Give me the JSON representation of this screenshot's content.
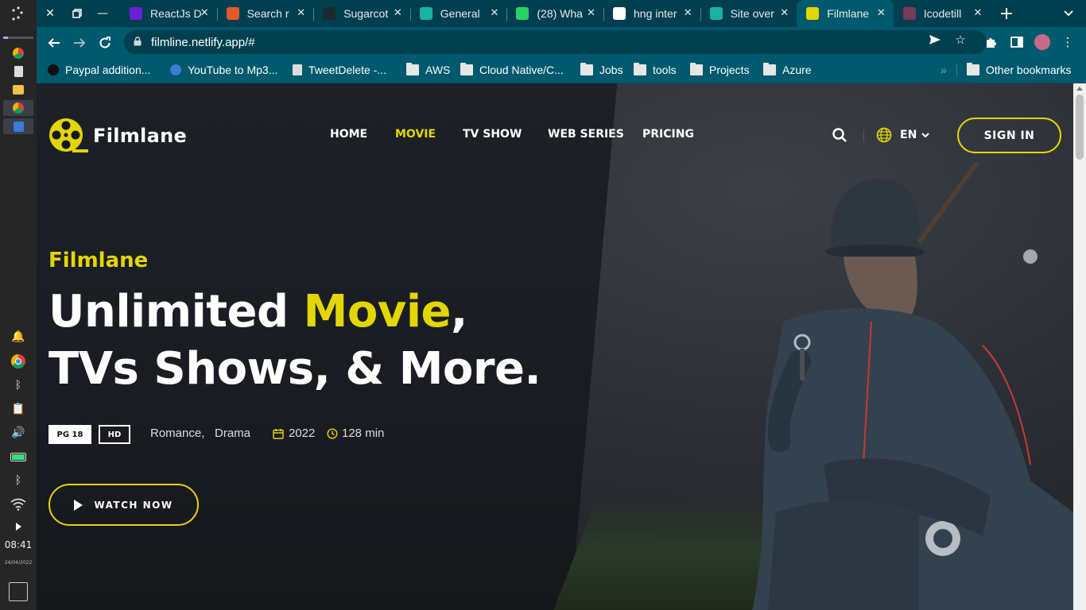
{
  "taskbar": {
    "time": "08:41",
    "date": "24/04/2022"
  },
  "browser": {
    "tabs": [
      {
        "title": "ReactJs D",
        "color": "#6b1fd6"
      },
      {
        "title": "Search r",
        "color": "#e05a2a"
      },
      {
        "title": "Sugarcot",
        "color": "#1b2a30"
      },
      {
        "title": "General",
        "color": "#19b3a0"
      },
      {
        "title": "(28) Wha",
        "color": "#25d366"
      },
      {
        "title": "hng inter",
        "color": "#ffffff"
      },
      {
        "title": "Site over",
        "color": "#19b3a0"
      },
      {
        "title": "Filmlane",
        "color": "#e2d703"
      },
      {
        "title": "Icodetill",
        "color": "#7a3b5a"
      }
    ],
    "active_tab_index": 7,
    "url": "filmline.netlify.app/#",
    "bookmarks": [
      "Paypal addition...",
      "YouTube to Mp3...",
      "TweetDelete -...",
      "AWS",
      "Cloud Native/C...",
      "Jobs",
      "tools",
      "Projects",
      "Azure"
    ],
    "other_bookmarks": "Other bookmarks"
  },
  "site": {
    "brand": "Filmlane",
    "accent_color": "#e2d703",
    "nav": [
      "HOME",
      "MOVIE",
      "TV SHOW",
      "WEB SERIES",
      "PRICING"
    ],
    "active_nav": "MOVIE",
    "language": "EN",
    "sign_in": "SIGN IN",
    "hero": {
      "subtitle": "Filmlane",
      "headline_part1": "Unlimited ",
      "headline_highlight": "Movie",
      "headline_part2": ",",
      "headline_line2": "TVs Shows, & More.",
      "rating_badge": "PG 18",
      "quality_badge": "HD",
      "genres": [
        "Romance,",
        "Drama"
      ],
      "year": "2022",
      "duration": "128 min",
      "cta": "WATCH NOW"
    }
  }
}
